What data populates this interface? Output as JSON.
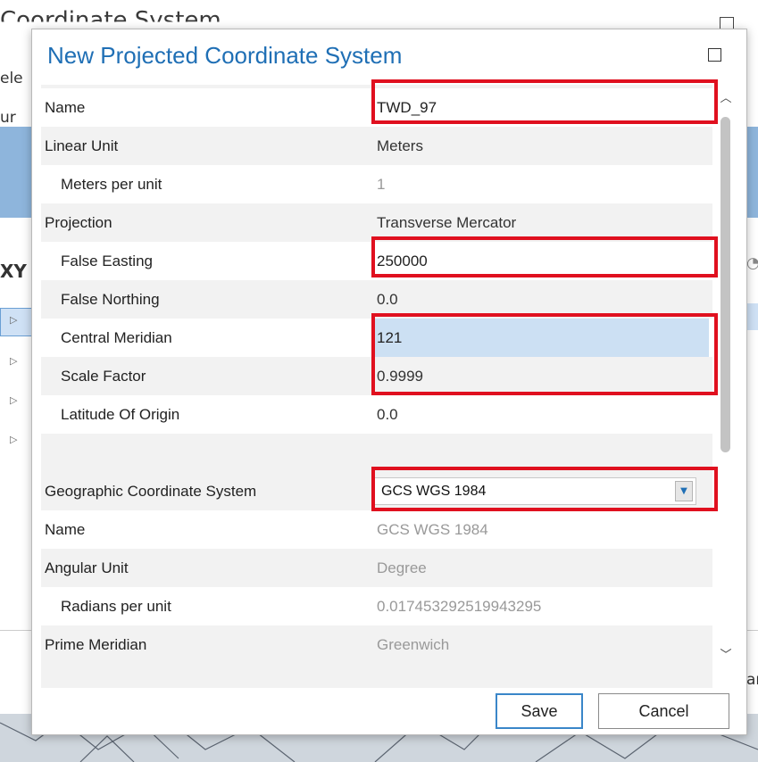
{
  "background": {
    "title": "Coordinate System",
    "side_texts": [
      "ele",
      "ur",
      "XY"
    ],
    "right_text": "ar"
  },
  "dialog": {
    "title": "New Projected Coordinate System",
    "rows": [
      {
        "label": "Name",
        "value": "TWD_97",
        "indent": false,
        "editable": true
      },
      {
        "label": "Linear Unit",
        "value": "Meters",
        "indent": false
      },
      {
        "label": "Meters per unit",
        "value": "1",
        "indent": true,
        "muted": true
      },
      {
        "label": "Projection",
        "value": "Transverse Mercator",
        "indent": false
      },
      {
        "label": "False Easting",
        "value": "250000",
        "indent": true,
        "editable": true
      },
      {
        "label": "False Northing",
        "value": "0.0",
        "indent": true
      },
      {
        "label": "Central Meridian",
        "value": "121",
        "indent": true,
        "selected": true
      },
      {
        "label": "Scale Factor",
        "value": "0.9999",
        "indent": true
      },
      {
        "label": "Latitude Of Origin",
        "value": "0.0",
        "indent": true
      }
    ],
    "gcs": {
      "label": "Geographic Coordinate System",
      "selected": "GCS WGS 1984"
    },
    "gcs_rows": [
      {
        "label": "Name",
        "value": "GCS WGS 1984",
        "indent": false
      },
      {
        "label": "Angular Unit",
        "value": "Degree",
        "indent": false
      },
      {
        "label": "Radians per unit",
        "value": "0.017453292519943295",
        "indent": true
      },
      {
        "label": "Prime Meridian",
        "value": "Greenwich",
        "indent": false
      }
    ],
    "buttons": {
      "save": "Save",
      "cancel": "Cancel"
    }
  },
  "colors": {
    "title_blue": "#1f6fb5",
    "highlight_red": "#e0101f",
    "selection": "#cce0f3"
  }
}
